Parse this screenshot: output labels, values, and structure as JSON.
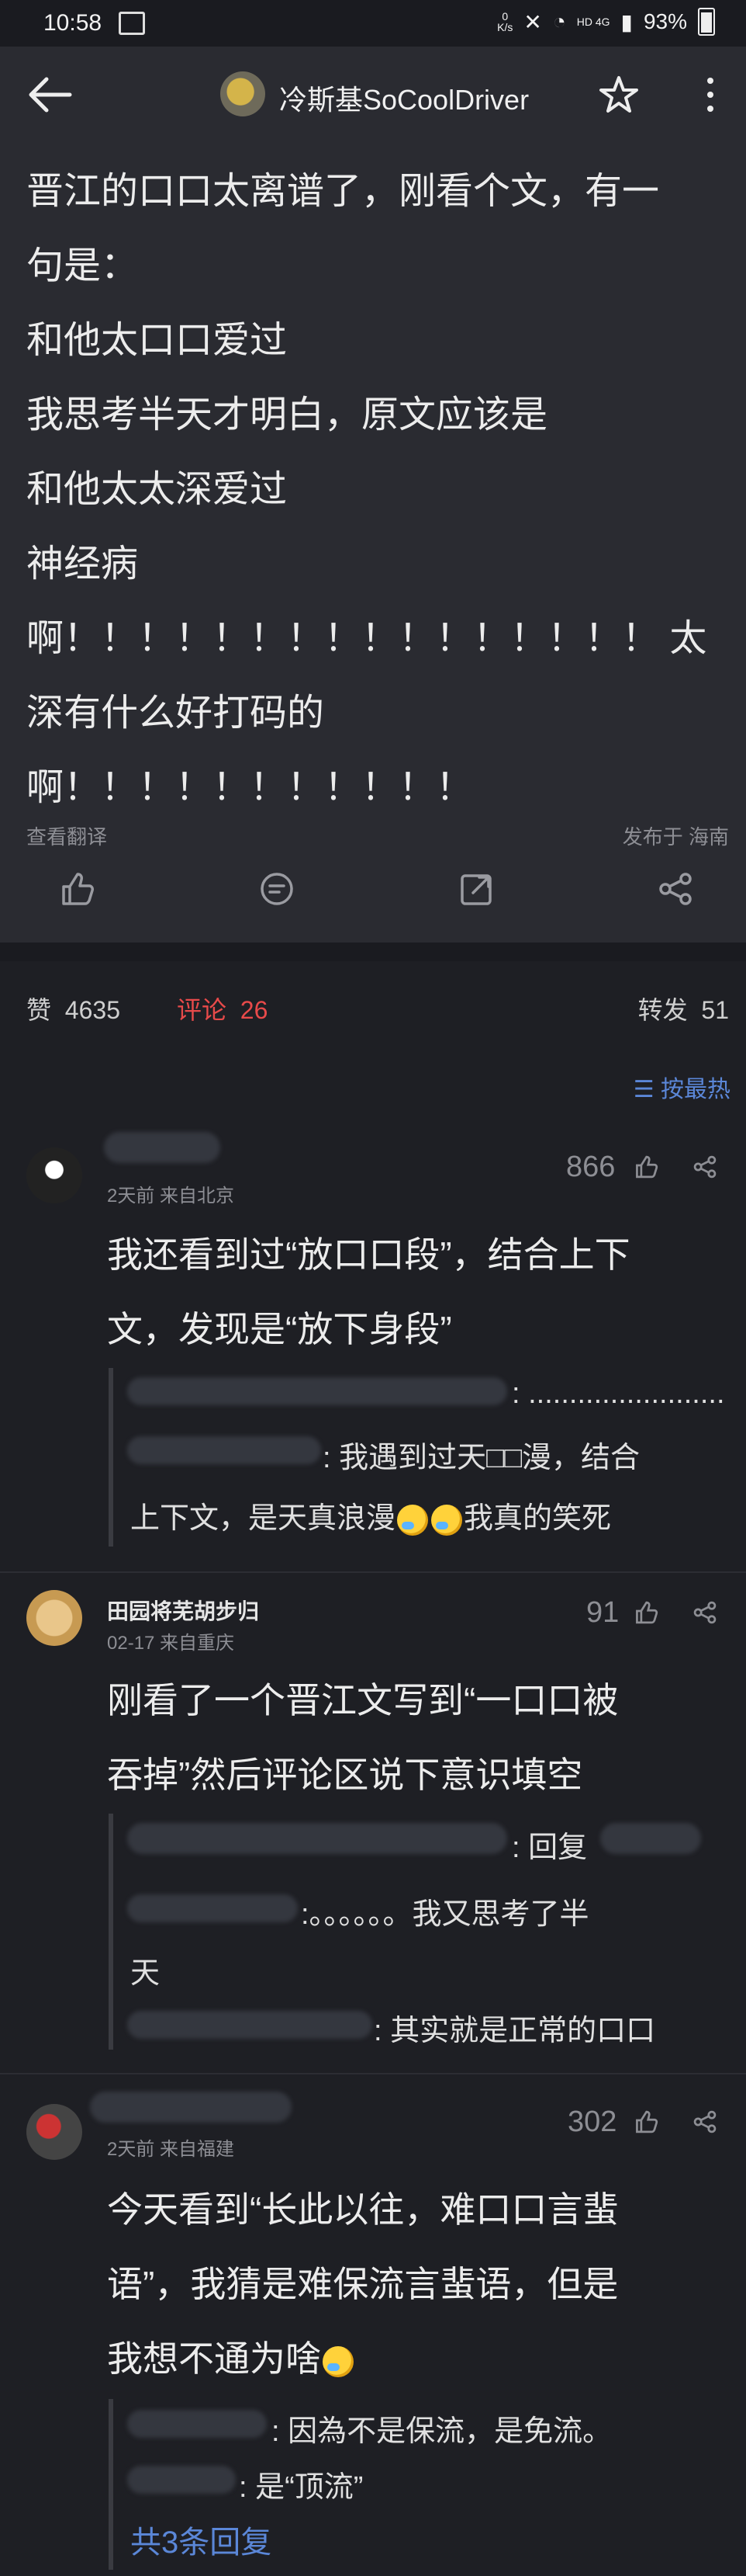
{
  "status": {
    "time": "10:58",
    "net_value": "0",
    "net_unit": "K/s",
    "network": "HD 4G",
    "battery": "93%"
  },
  "header": {
    "username": "冷斯基SoCoolDriver"
  },
  "post": {
    "lines": [
      "晋江的口口太离谱了，刚看个文，有一",
      "句是：",
      "和他太口口爱过",
      "我思考半天才明白，原文应该是",
      "和他太太深爱过",
      "神经病",
      "啊！！！！！！！！！！！！！！！！ 太",
      "深有什么好打码的",
      "啊！！！！！！！！！！！"
    ],
    "translate": "查看翻译",
    "location": "发布于 海南"
  },
  "counts": {
    "likes_label": "赞",
    "likes": "4635",
    "comments_label": "评论",
    "comments": "26",
    "reposts_label": "转发",
    "reposts": "51"
  },
  "sort_label": "按最热",
  "comments": [
    {
      "meta": "2天前  来自北京",
      "likes": "866",
      "text_lines": [
        "我还看到过“放口口段”，结合上下",
        "文，发现是“放下身段”"
      ],
      "replies": [
        ": ........................",
        ": 我遇到过天□□漫，结合",
        "上下文，是天真浪漫",
        "我真的笑死"
      ]
    },
    {
      "name": "田园将芜胡步归",
      "meta": "02-17  来自重庆",
      "likes": "91",
      "text_lines": [
        "刚看了一个晋江文写到“一口口被",
        "吞掉”然后评论区说下意识填空"
      ],
      "replies": [
        ": 回复",
        ":。。。。。。我又思考了半",
        "天",
        ": 其实就是正常的口口"
      ]
    },
    {
      "meta": "2天前  来自福建",
      "likes": "302",
      "text_lines": [
        "今天看到“长此以往，难口口言蜚",
        "语”，我猜是难保流言蜚语，但是",
        "我想不通为啥"
      ],
      "replies": [
        ": 因為不是保流，是免流。",
        ": 是“顶流”"
      ],
      "total": "共3条回复"
    }
  ]
}
